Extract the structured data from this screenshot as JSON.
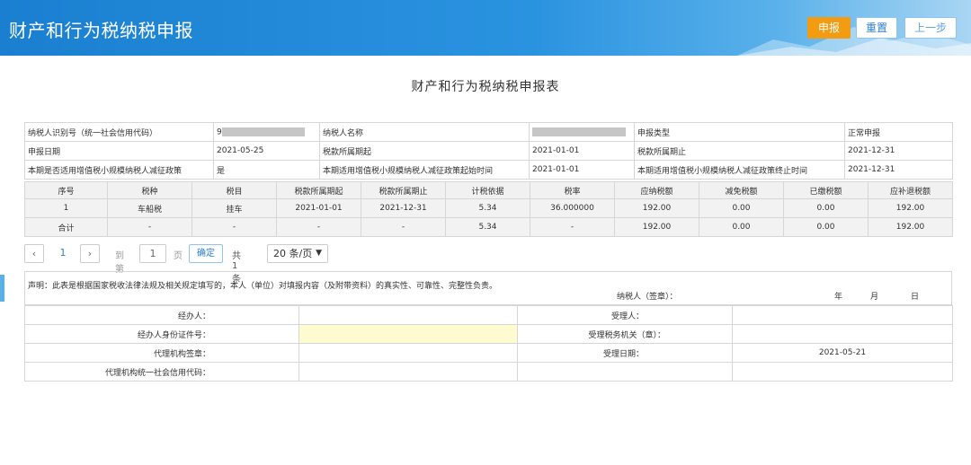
{
  "header": {
    "title": "财产和行为税纳税申报",
    "buttons": {
      "submit": "申报",
      "reset": "重置",
      "prev": "上一步"
    },
    "colors": {
      "bar": "#2a93e0",
      "submit": "#f39c12"
    }
  },
  "form_title": "财产和行为税纳税申报表",
  "info": {
    "taxpayer_id_label": "纳税人识别号（统一社会信用代码）",
    "taxpayer_id_value": "9",
    "taxpayer_name_label": "纳税人名称",
    "taxpayer_name_value": "",
    "declare_type_label": "申报类型",
    "declare_type_value": "正常申报",
    "declare_date_label": "申报日期",
    "declare_date_value": "2021-05-25",
    "period_start_label": "税款所属期起",
    "period_start_value": "2021-01-01",
    "period_end_label": "税款所属期止",
    "period_end_value": "2021-12-31",
    "small_scale_label": "本期是否适用增值税小规模纳税人减征政策",
    "small_scale_value": "是",
    "policy_start_label": "本期适用增值税小规模纳税人减征政策起始时间",
    "policy_start_value": "2021-01-01",
    "policy_end_label": "本期适用增值税小规模纳税人减征政策终止时间",
    "policy_end_value": "2021-12-31"
  },
  "detail": {
    "columns": [
      "序号",
      "税种",
      "税目",
      "税款所属期起",
      "税款所属期止",
      "计税依据",
      "税率",
      "应纳税额",
      "减免税额",
      "已缴税额",
      "应补退税额"
    ],
    "rows": [
      [
        "1",
        "车船税",
        "挂车",
        "2021-01-01",
        "2021-12-31",
        "5.34",
        "36.000000",
        "192.00",
        "0.00",
        "0.00",
        "192.00"
      ],
      [
        "合计",
        "-",
        "-",
        "-",
        "-",
        "5.34",
        "-",
        "192.00",
        "0.00",
        "0.00",
        "192.00"
      ]
    ]
  },
  "pager": {
    "prev": "‹",
    "current": "1",
    "next": "›",
    "goto_label": "到第",
    "goto_value": "1",
    "page_label": "页",
    "confirm": "确定",
    "total": "共 1 条",
    "page_size": "20 条/页"
  },
  "declaration": {
    "text": "声明：此表是根据国家税收法律法规及相关规定填写的，本人（单位）对填报内容（及附带资料）的真实性、可靠性、完整性负责。",
    "sign_label": "纳税人（签章）：",
    "year": "年",
    "month": "月",
    "day": "日"
  },
  "sign": {
    "handler_label": "经办人：",
    "receiver_label": "受理人：",
    "handler_id_label": "经办人身份证件号：",
    "receiver_org_label": "受理税务机关（章）：",
    "agency_seal_label": "代理机构签章：",
    "accept_date_label": "受理日期：",
    "accept_date_value": "2021-05-21",
    "agency_code_label": "代理机构统一社会信用代码："
  }
}
